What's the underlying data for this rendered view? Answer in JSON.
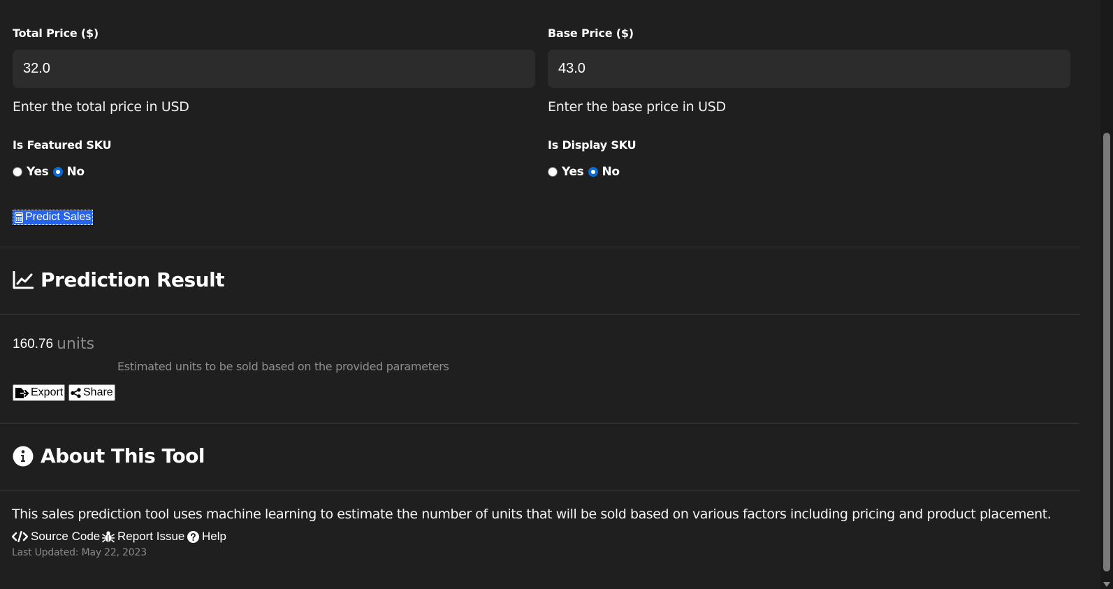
{
  "form": {
    "total_price": {
      "label": "Total Price ($)",
      "value": "32.0",
      "help": "Enter the total price in USD"
    },
    "base_price": {
      "label": "Base Price ($)",
      "value": "43.0",
      "help": "Enter the base price in USD"
    },
    "featured_sku": {
      "label": "Is Featured SKU",
      "options": [
        "Yes",
        "No"
      ],
      "selected": "No"
    },
    "display_sku": {
      "label": "Is Display SKU",
      "options": [
        "Yes",
        "No"
      ],
      "selected": "No"
    },
    "predict_button": {
      "label": "Predict Sales",
      "icon": "calculator-icon",
      "color": "#2563eb"
    }
  },
  "result": {
    "title": "Prediction Result",
    "icon": "line-chart-icon",
    "value": "160.76",
    "unit": "units",
    "description": "Estimated units to be sold based on the provided parameters",
    "export_label": "Export",
    "share_label": "Share"
  },
  "about": {
    "title": "About This Tool",
    "icon": "info-circle-icon",
    "text": "This sales prediction tool uses machine learning to estimate the number of units that will be sold based on various factors including pricing and product placement.",
    "links": {
      "source_code": "Source Code",
      "report_issue": "Report Issue",
      "help": "Help"
    },
    "last_updated": "Last Updated: May 22, 2023"
  }
}
